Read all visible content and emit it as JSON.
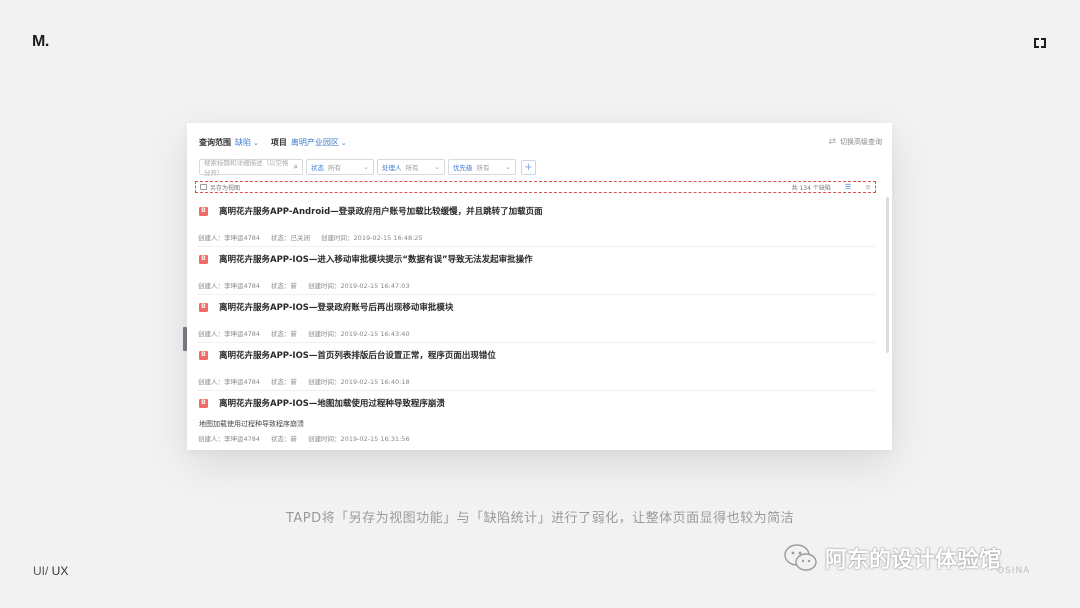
{
  "brand": {
    "logo_text": "M.",
    "corner_icon": "corner-bracket-icon"
  },
  "footer": {
    "tag_main": "UI/",
    "tag_sub": " UX"
  },
  "caption": "TAPD将「另存为视图功能」与「缺陷统计」进行了弱化，让整体页面显得也较为简洁",
  "watermark": {
    "text": "阿东的设计体验馆",
    "sub": "OSINA",
    "icon": "wechat-icon"
  },
  "app": {
    "scope": {
      "label": "查询范围",
      "value": "缺陷",
      "project_label": "项目",
      "project_value": "离明产业园区"
    },
    "switch_advanced": "切换高级查询",
    "search": {
      "placeholder": "搜索标题和详细描述（以空格分开）"
    },
    "filters": [
      {
        "key": "状态",
        "value": "所有"
      },
      {
        "key": "处理人",
        "value": "所有"
      },
      {
        "key": "优先级",
        "value": "所有"
      }
    ],
    "view_bar": {
      "save_label": "另存为视图",
      "count_label": "共 134 个缺陷"
    },
    "items": [
      {
        "badge": "B",
        "title": "离明花卉服务APP-Android—登录政府用户账号加载比较缓慢，并且跳转了加载页面",
        "desc": "",
        "creator": "创建人：李坤运4784",
        "status": "状态：已关闭",
        "created": "创建时间：2019-02-15 16:48:25"
      },
      {
        "badge": "B",
        "title": "离明花卉服务APP-IOS—进入移动审批模块提示“数据有误”导致无法发起审批操作",
        "desc": "",
        "creator": "创建人：李坤运4784",
        "status": "状态：新",
        "created": "创建时间：2019-02-15 16:47:03"
      },
      {
        "badge": "B",
        "title": "离明花卉服务APP-IOS—登录政府账号后再出现移动审批模块",
        "desc": "",
        "creator": "创建人：李坤运4784",
        "status": "状态：新",
        "created": "创建时间：2019-02-15 16:43:40"
      },
      {
        "badge": "B",
        "title": "离明花卉服务APP-IOS—首页列表排版后台设置正常，程序页面出现错位",
        "desc": "",
        "creator": "创建人：李坤运4784",
        "status": "状态：新",
        "created": "创建时间：2019-02-15 16:40:18"
      },
      {
        "badge": "B",
        "title": "离明花卉服务APP-IOS—地图加载使用过程种导致程序崩溃",
        "desc": "地图加载使用过程种导致程序崩溃",
        "creator": "创建人：李坤运4784",
        "status": "状态：新",
        "created": "创建时间：2019-02-15 16:31:56"
      }
    ]
  },
  "colors": {
    "accent": "#3d7bd6",
    "badge": "#ee6b67",
    "dashed_border": "#e0504d",
    "background": "#f2f2f3"
  }
}
